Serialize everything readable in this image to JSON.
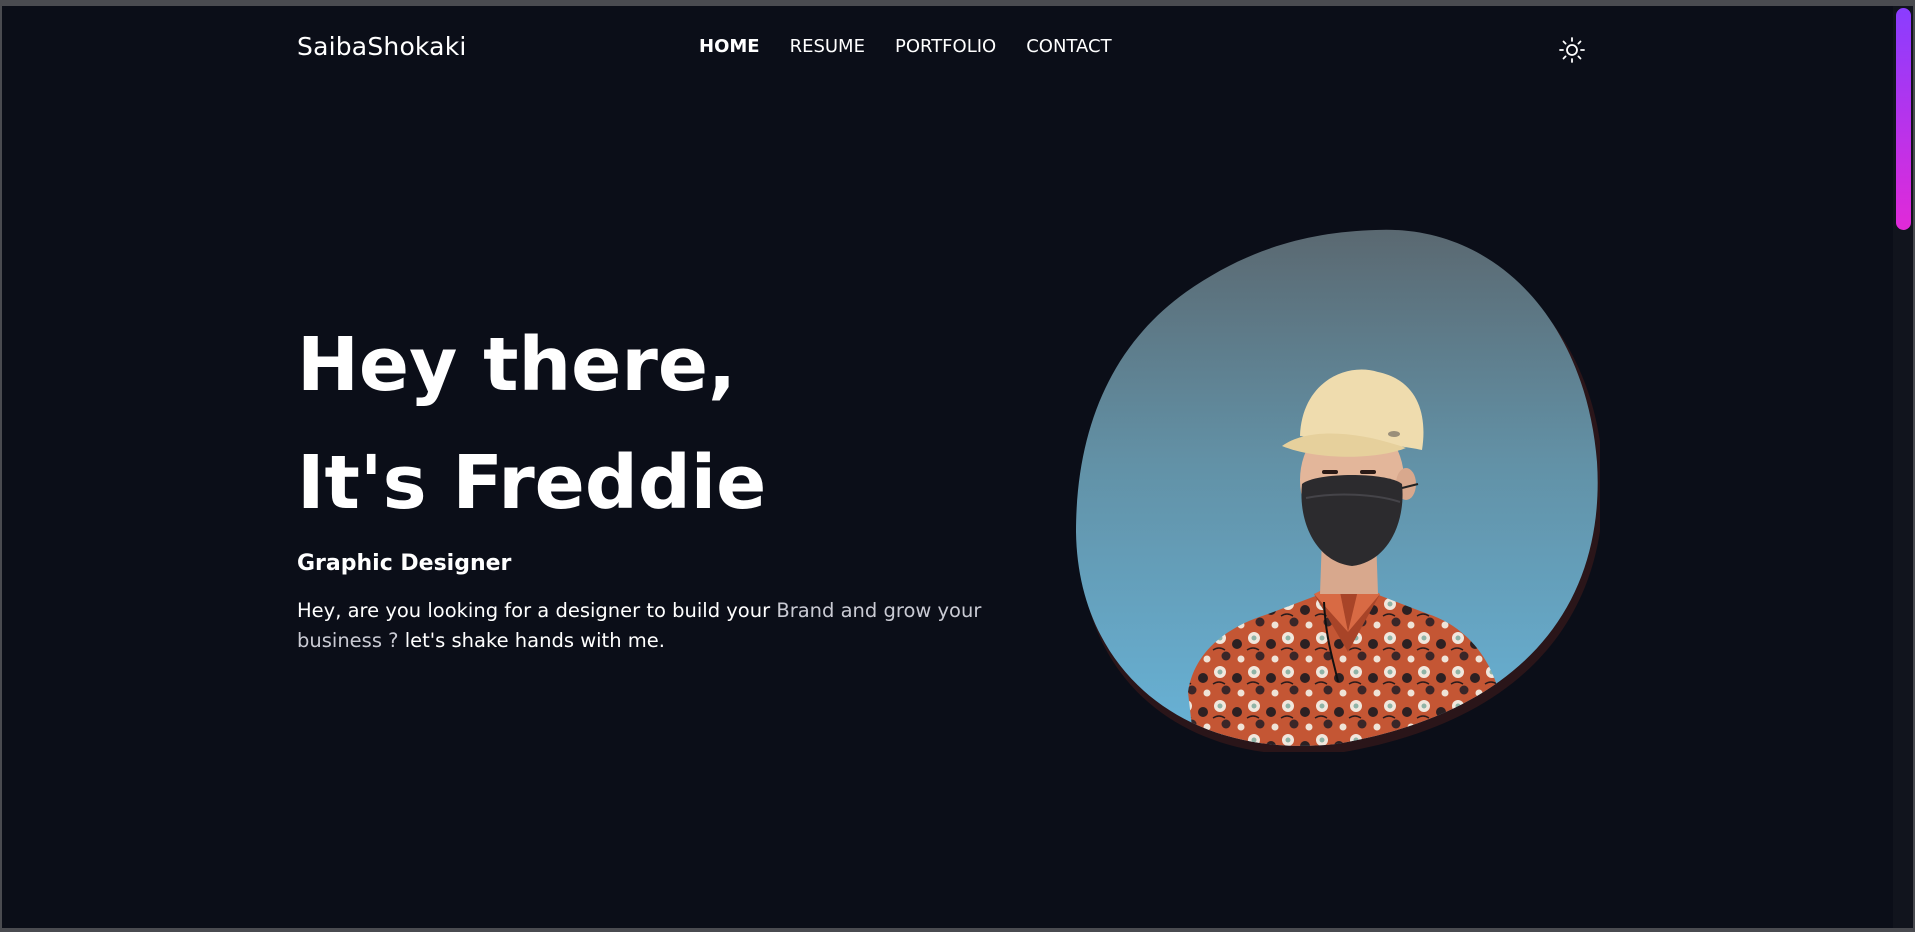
{
  "brand": "SaibaShokaki",
  "nav": {
    "items": [
      {
        "label": "HOME",
        "active": true
      },
      {
        "label": "RESUME",
        "active": false
      },
      {
        "label": "PORTFOLIO",
        "active": false
      },
      {
        "label": "CONTACT",
        "active": false
      }
    ],
    "theme_toggle_icon": "sun-icon"
  },
  "hero": {
    "title_line1": "Hey there,",
    "title_line2": "It's Freddie",
    "role": "Graphic Designer",
    "intro_part1": "Hey, are you looking for a designer to build your ",
    "intro_highlight": "Brand and grow your business ?",
    "intro_part2": " let's shake hands with me."
  },
  "colors": {
    "background": "#0b0e18",
    "text": "#ffffff",
    "muted_text": "#c9cad3",
    "scroll_thumb_top": "#8a3dff",
    "scroll_thumb_bottom": "#e12ad8"
  }
}
